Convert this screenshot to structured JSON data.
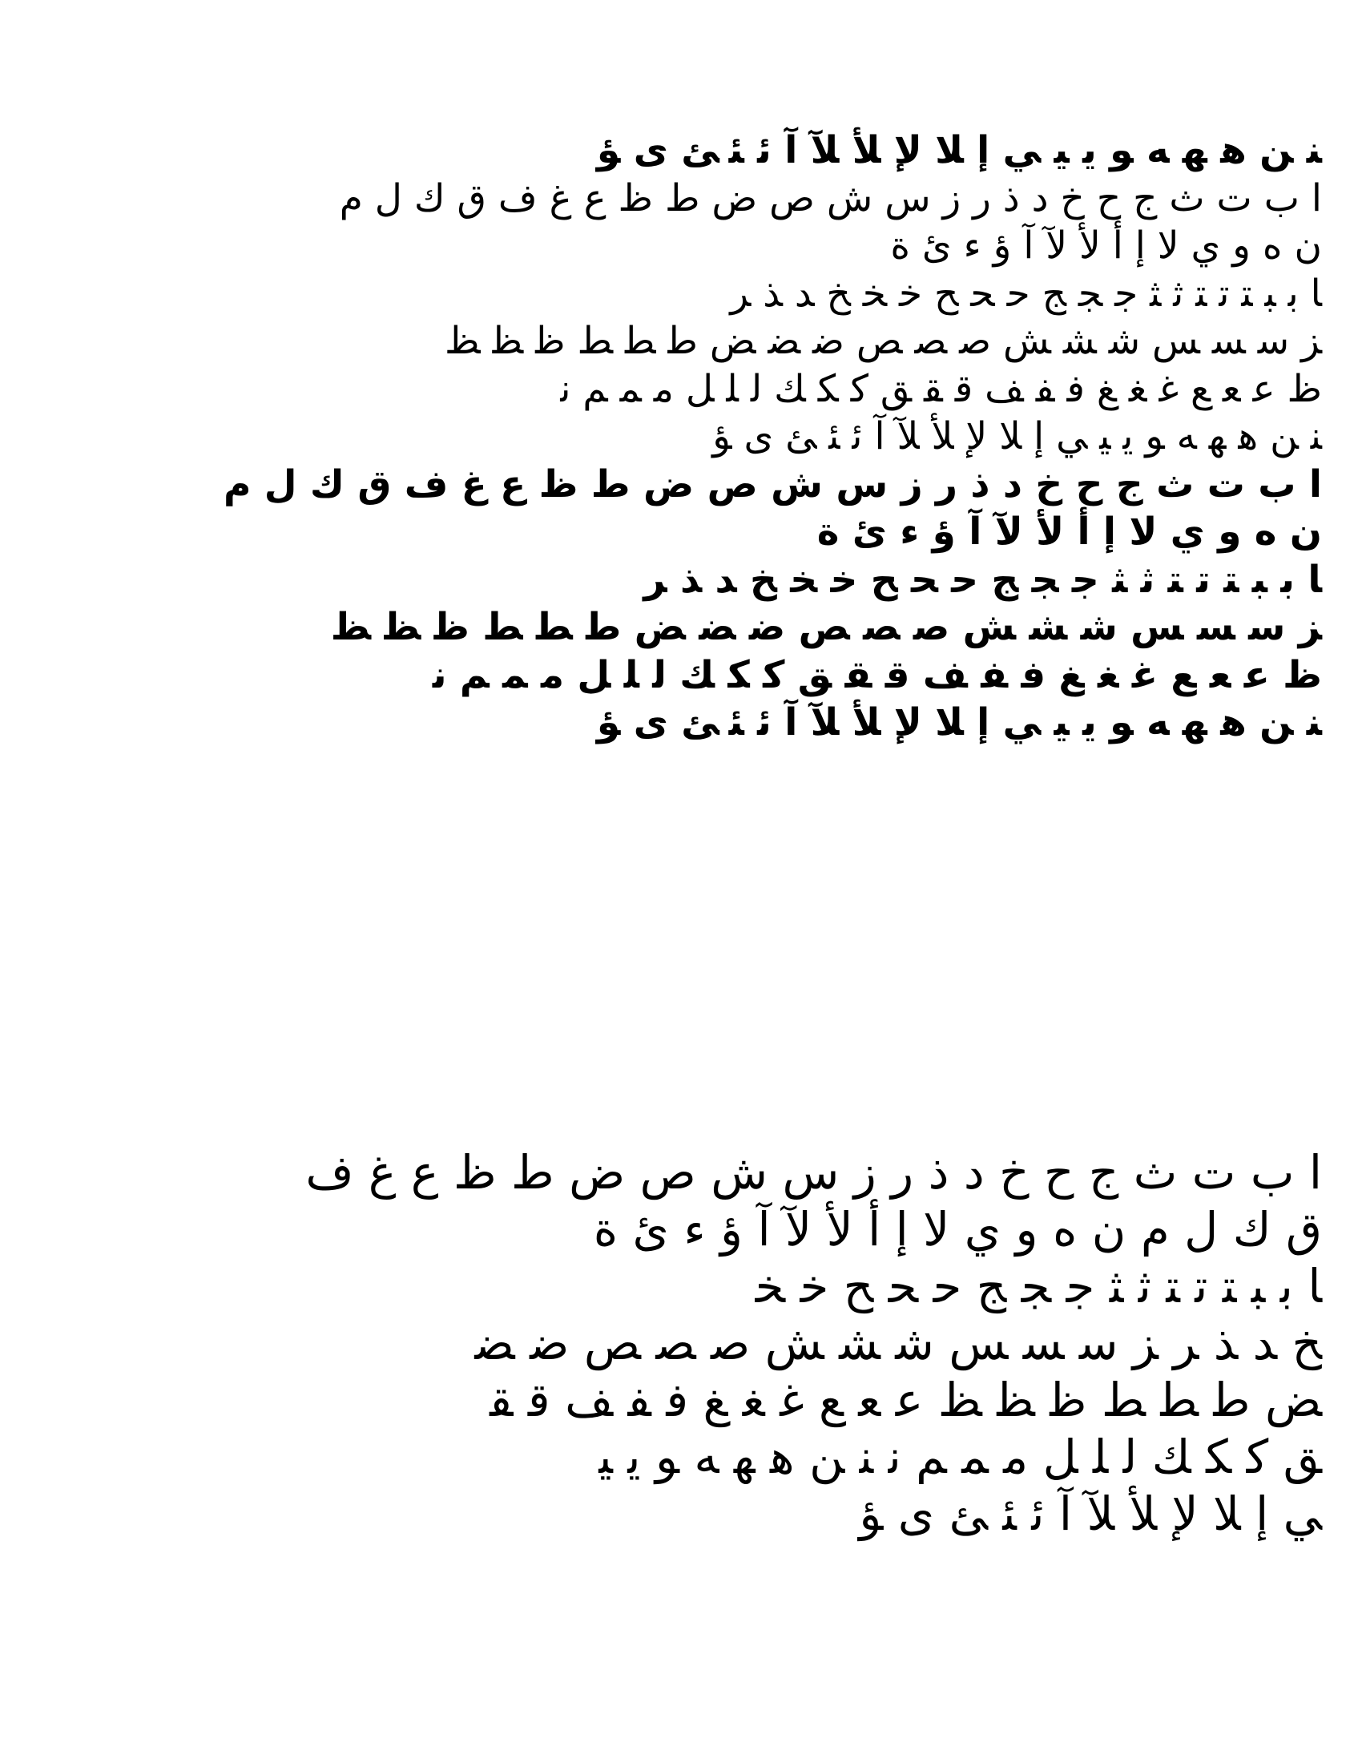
{
  "document": {
    "block1": {
      "lines": [
        "ﻨ ﻦ ﻫ ﻬ ﻪ ﻮ ﻳ ﻴ ﻲ ﺇ ﻼ ﻹ ﻸ ﻶ ﺁ ﺋ ﺌ ﺊ ﻯ ﺆ",
        "ا ب ت ث ج ح خ د ذ ر ز س ش ص ض ط ظ ع غ ف ق ك ل م",
        "ن ه و ي ﻻ إ أ ﻷ ﻵ آ ؤ ء ئ ة",
        "ﺎ ﺑ ﺒ ﺘ ﺗ ﺘ ﺛ ﺜ ﺟ ﺠ ﺞ ﺣ ﺤ ﺢ ﺧ ﺨ ﺦ ﺪ ﺬ ﺮ",
        "ﺰ ﺳ ﺴ ﺲ ﺷ ﺸ ﺶ ﺻ ﺼ ﺺ ﺿ ﻀ ﺾ ﻃ ﻄ ﻂ ﻇ ﻈ ﻆ",
        "ﻅ ﻋ ﻌ ﻊ ﻏ ﻐ ﻎ ﻓ ﻔ ﻒ ﻗ ﻘ ﻖ ﻛ ﻜ ﻚ ﻟ ﻠ ﻞ ﻣ ﻤ ﻢ ﻧ",
        "ﻨ ﻦ ﻫ ﻬ ﻪ ﻮ ﻳ ﻴ ﻲ ﺇ ﻼ ﻹ ﻸ ﻶ ﺁ ﺋ ﺌ ﺊ ﻯ ﺆ",
        "ا ب ت ث ج ح خ د ذ ر ز س ش ص ض ط ظ ع غ ف ق ك ل م",
        "ن ه و ي ﻻ إ أ ﻷ ﻵ آ ؤ ء ئ ة",
        "ﺎ ﺑ ﺒ ﺘ ﺗ ﺘ ﺛ ﺜ ﺟ ﺠ ﺞ ﺣ ﺤ ﺢ ﺧ ﺨ ﺦ ﺪ ﺬ ﺮ",
        "ﺰ ﺳ ﺴ ﺲ ﺷ ﺸ ﺶ ﺻ ﺼ ﺺ ﺿ ﻀ ﺾ ﻃ ﻄ ﻂ ﻇ ﻈ ﻆ",
        "ﻅ ﻋ ﻌ ﻊ ﻏ ﻐ ﻎ ﻓ ﻔ ﻒ ﻗ ﻘ ﻖ ﻛ ﻜ ﻚ ﻟ ﻠ ﻞ ﻣ ﻤ ﻢ ﻧ",
        "ﻨ ﻦ ﻫ ﻬ ﻪ ﻮ ﻳ ﻴ ﻲ ﺇ ﻼ ﻹ ﻸ ﻶ ﺁ ﺋ ﺌ ﺊ ﻯ ﺆ"
      ]
    },
    "block2": {
      "lines": [
        "ا ب ت ث ج ح خ د ذ ر ز س ش ص ض ط ظ ع غ ف",
        "ق ك ل م ن ه و ي ﻻ إ أ ﻷ ﻵ آ ؤ ء ئ ة",
        "ﺎ ﺑ ﺒ ﺘ ﺗ ﺘ ﺛ ﺜ ﺟ ﺠ ﺞ ﺣ ﺤ ﺢ ﺧ ﺨ",
        "ﺦ ﺪ ﺬ ﺮ ﺰ ﺳ ﺴ ﺲ ﺷ ﺸ ﺶ ﺻ ﺼ ﺺ ﺿ ﻀ",
        "ﺾ ﻃ ﻄ ﻂ ﻇ ﻈ ﻆ ﻋ ﻌ ﻊ ﻏ ﻐ ﻎ ﻓ ﻔ ﻒ ﻗ ﻘ",
        "ﻖ ﻛ ﻜ ﻚ ﻟ ﻠ ﻞ ﻣ ﻤ ﻢ ﻧ ﻨ ﻦ ﻫ ﻬ ﻪ ﻮ ﻳ ﻴ",
        "ﻲ ﺇ ﻼ ﻹ ﻸ ﻶ ﺁ ﺋ ﺌ ﺊ ﻯ ﺆ"
      ]
    }
  }
}
